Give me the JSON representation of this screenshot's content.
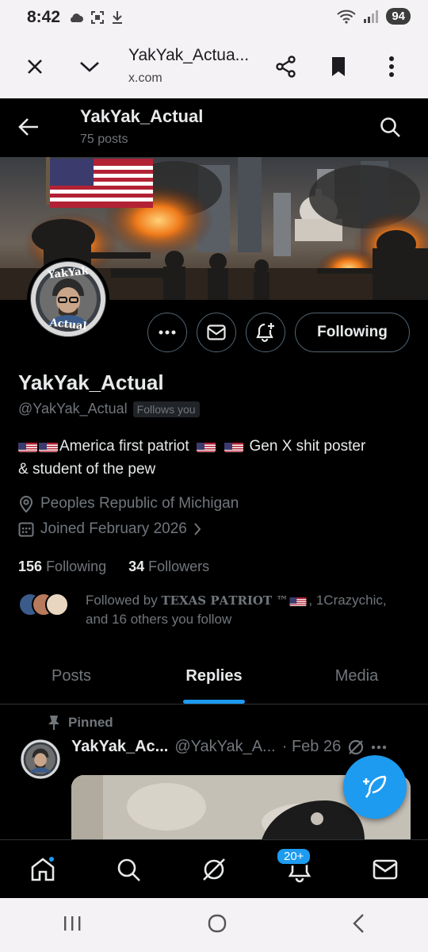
{
  "status_bar": {
    "time": "8:42",
    "battery": "94"
  },
  "browser": {
    "page_title": "YakYak_Actua...",
    "url": "x.com"
  },
  "header": {
    "title": "YakYak_Actual",
    "post_count": "75 posts"
  },
  "profile": {
    "display_name": "YakYak_Actual",
    "handle": "@YakYak_Actual",
    "follows_you": "Follows you",
    "bio_line1": "America first patriot",
    "bio_line1b": "Gen X shit poster",
    "bio_line2": "& student of the pew",
    "location": "Peoples Republic of Michigan",
    "joined": "Joined February 2026",
    "following_count": "156",
    "following_label": "Following",
    "followers_count": "34",
    "followers_label": "Followers",
    "followed_by_prefix": "Followed by ",
    "followed_by_name": "𝐓𝐄𝐗𝐀𝐒 𝐏𝐀𝐓𝐑𝐈𝐎𝐓 ™",
    "followed_by_rest": ", 1Crazychic,",
    "followed_by_line2": "and 16 others you follow",
    "follow_button": "Following",
    "avatar_text_top": "YakYak",
    "avatar_text_bottom": "Actual"
  },
  "tabs": [
    {
      "label": "Posts",
      "active": false
    },
    {
      "label": "Replies",
      "active": true
    },
    {
      "label": "Media",
      "active": false
    }
  ],
  "pinned_tweet": {
    "pinned_label": "Pinned",
    "name": "YakYak_Ac...",
    "handle": "@YakYak_A...",
    "date": "· Feb 26"
  },
  "bottom_nav": {
    "notifications_badge": "20+"
  },
  "colors": {
    "accent": "#1d9bf0",
    "background": "#000000",
    "muted": "#71767b"
  },
  "icons": [
    "back-arrow-icon",
    "search-icon",
    "more-icon",
    "message-icon",
    "notification-add-icon",
    "location-icon",
    "calendar-icon",
    "pin-icon",
    "grok-icon",
    "compose-icon",
    "home-icon",
    "bell-icon",
    "mail-icon",
    "close-icon",
    "chevron-down-icon",
    "share-icon",
    "bookmark-icon",
    "menu-dots-icon"
  ]
}
